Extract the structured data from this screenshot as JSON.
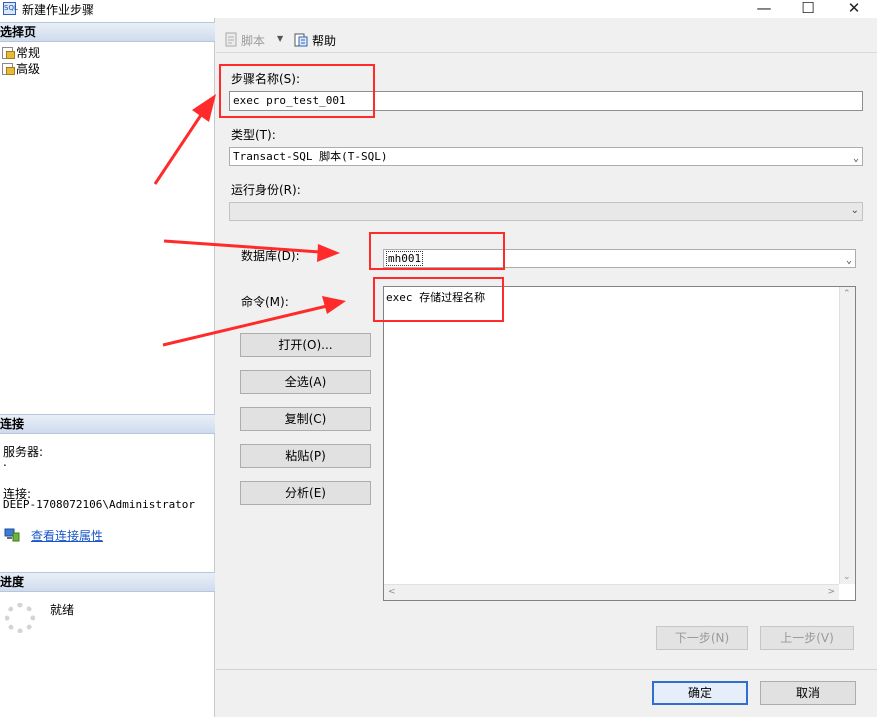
{
  "window": {
    "title": "新建作业步骤",
    "icon_label": "SQL",
    "controls": {
      "minimize": "—",
      "maximize": "☐",
      "close": "✕"
    }
  },
  "left_panel": {
    "select_page_header": "选择页",
    "pages": [
      {
        "label": "常规"
      },
      {
        "label": "高级"
      }
    ],
    "connection_header": "连接",
    "server_label": "服务器:",
    "server_value": ".",
    "connection_label": "连接:",
    "connection_value": "DEEP-1708072106\\Administrator",
    "view_connection_link": "查看连接属性",
    "progress_header": "进度",
    "progress_status": "就绪"
  },
  "toolbar": {
    "script_label": "脚本",
    "dropdown_glyph": "▼",
    "help_label": "帮助"
  },
  "form": {
    "step_name_label": "步骤名称(S):",
    "step_name_value": "exec  pro_test_001",
    "type_label": "类型(T):",
    "type_value": "Transact-SQL 脚本(T-SQL)",
    "run_as_label": "运行身份(R):",
    "run_as_value": "",
    "database_label": "数据库(D):",
    "database_value": "mh001",
    "command_label": "命令(M):",
    "command_value": "exec 存储过程名称",
    "buttons": {
      "open": "打开(O)...",
      "select_all": "全选(A)",
      "copy": "复制(C)",
      "paste": "粘贴(P)",
      "parse": "分析(E)"
    },
    "next_button": "下一步(N)",
    "prev_button": "上一步(V)"
  },
  "footer": {
    "ok_button": "确定",
    "cancel_button": "取消"
  },
  "colors": {
    "annotation_red": "#ff2a2a",
    "link_blue": "#1a55c9",
    "header_gradient_top": "#e9eff8",
    "header_gradient_bottom": "#cfdcee"
  }
}
